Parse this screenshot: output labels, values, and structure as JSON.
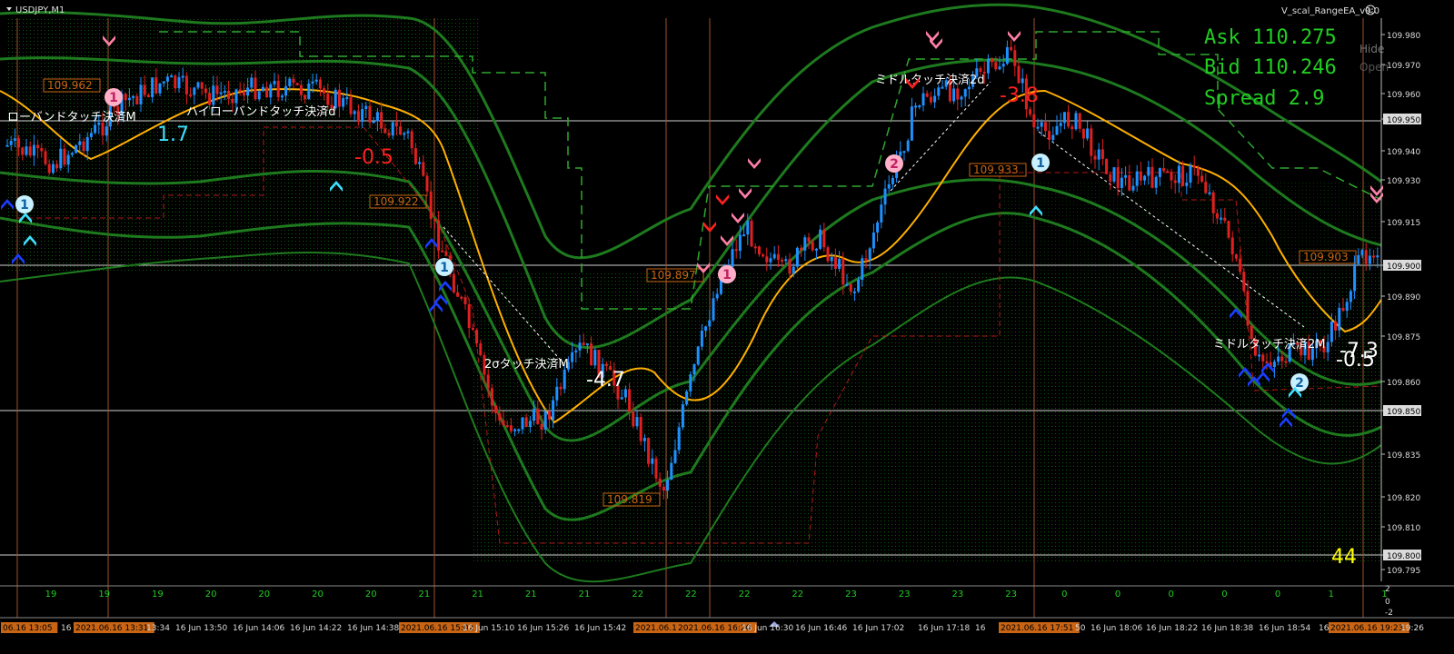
{
  "window": {
    "symbol_label": "USDJPY,M1",
    "ea_label": "V_scal_RangeEA_v9.0",
    "ea_icon": "smiley-icon",
    "side_buttons": [
      "Hide",
      "Open"
    ],
    "menu_icon": "triangle-down-icon"
  },
  "info_panel": {
    "ask": "Ask 110.275",
    "bid": "Bid 110.246",
    "spread": "Spread 2.9",
    "color": "#22cc22"
  },
  "price_axis": {
    "labels": [
      "109.980",
      "109.970",
      "109.960",
      "109.950",
      "109.940",
      "109.930",
      "109.915",
      "109.900",
      "109.890",
      "109.875",
      "109.860",
      "109.850",
      "109.835",
      "109.820",
      "109.810",
      "109.800",
      "109.795"
    ],
    "highlighted": [
      "109.950",
      "109.900",
      "109.850",
      "109.800"
    ]
  },
  "time_axis": {
    "labels": [
      "06.16 13:05",
      "16",
      "2021.06.16 13:31",
      "13:34",
      "16 Jun 13:50",
      "16 Jun 14:06",
      "16 Jun 14:22",
      "16 Jun 14:38",
      "2021.06.16 15:02",
      "16 Jun 15:10",
      "16 Jun 15:26",
      "16 Jun 15:42",
      "2021.06.16",
      "2021.06.16 16:20",
      "16 Jun 16:30",
      "16 Jun 16:46",
      "16 Jun 17:02",
      "16 Jun 17:18",
      "16",
      "2021.06.16 17:51",
      "50",
      "16 Jun 18:06",
      "16 Jun 18:22",
      "16 Jun 18:38",
      "16 Jun 18:54",
      "16",
      "2021.06.16 19:23",
      "19:26"
    ],
    "highlighted": [
      "06.16 13:05",
      "2021.06.16 13:31",
      "2021.06.16 15:02",
      "2021.06.16",
      "2021.06.16 16:20",
      "2021.06.16 17:51",
      "2021.06.16 19:23"
    ]
  },
  "sub_window": {
    "values": [
      "19",
      "19",
      "19",
      "20",
      "20",
      "20",
      "20",
      "21",
      "21",
      "21",
      "21",
      "22",
      "22",
      "22",
      "22",
      "23",
      "23",
      "23",
      "23",
      "0",
      "0",
      "0",
      "0",
      "0",
      "1",
      "1"
    ],
    "scale": [
      "2",
      "0",
      "-2"
    ]
  },
  "level_labels": [
    "109.962",
    "109.922",
    "109.897",
    "109.819",
    "109.933",
    "109.903"
  ],
  "annotations": {
    "lower_band_close": "ローバンドタッチ決済M",
    "upper_band_close": "ハイローバンドタッチ決済d",
    "sigma2_close": "2σタッチ決済M",
    "middle_close_1": "ミドルタッチ決済2d",
    "middle_close_2": "ミドルタッチ決済2M"
  },
  "profits": {
    "p1": "1.7",
    "p2": "-0.5",
    "p3": "-4.7",
    "p4": "-3.8",
    "p5": "-7.3",
    "p6": "-0.5",
    "counter": "44"
  },
  "markers": {
    "one": "1",
    "two": "2"
  },
  "colors": {
    "bg": "#000000",
    "grid_dot": "#0a5a0a",
    "band": "#1e7a1e",
    "ma": "#ffb000",
    "bull": "#1e90ff",
    "bear": "#e02020",
    "level_box": "#c86414",
    "vline": "#a0522d",
    "pink": "#ff7fa8",
    "cyan": "#40e0ff",
    "yellow": "#ffff00"
  }
}
